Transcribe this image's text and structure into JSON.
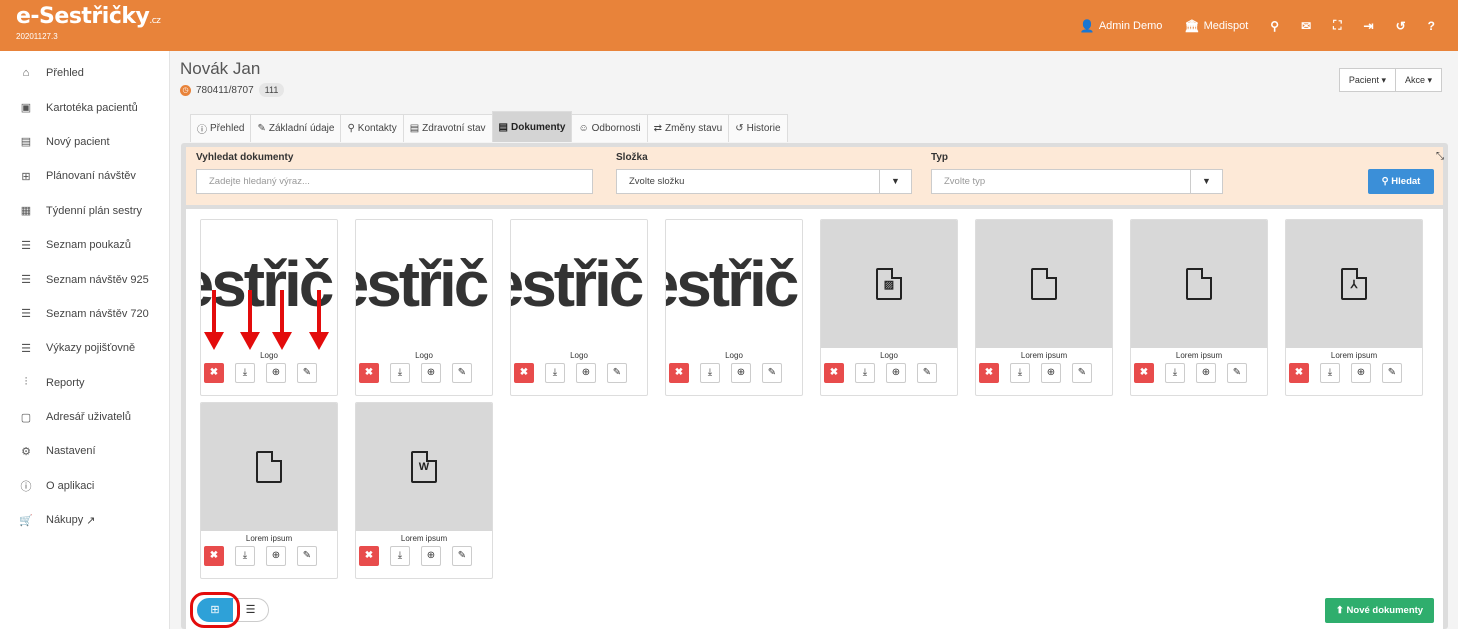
{
  "brand": {
    "logo": "e-Sestřičky",
    "logo_suffix": ".cz",
    "version": "20201127.3",
    "accent": "#e8833a"
  },
  "topnav": [
    {
      "icon": "user-icon",
      "label": "Admin Demo"
    },
    {
      "icon": "building-icon",
      "label": "Medispot"
    },
    {
      "icon": "search-icon",
      "label": ""
    },
    {
      "icon": "envelope-icon",
      "label": ""
    },
    {
      "icon": "fullscreen-icon",
      "label": ""
    },
    {
      "icon": "logout-icon",
      "label": ""
    },
    {
      "icon": "history-icon",
      "label": ""
    },
    {
      "icon": "help-icon",
      "label": ""
    }
  ],
  "sidebar": {
    "items": [
      {
        "icon": "home-icon",
        "label": "Přehled"
      },
      {
        "icon": "id-card-icon",
        "label": "Kartotéka pacientů"
      },
      {
        "icon": "new-patient-icon",
        "label": "Nový pacient"
      },
      {
        "icon": "map-icon",
        "label": "Plánovaní návštěv"
      },
      {
        "icon": "calendar-icon",
        "label": "Týdenní plán sestry"
      },
      {
        "icon": "list-icon",
        "label": "Seznam poukazů"
      },
      {
        "icon": "list-icon",
        "label": "Seznam návštěv 925"
      },
      {
        "icon": "list-icon",
        "label": "Seznam návštěv 720"
      },
      {
        "icon": "list-icon",
        "label": "Výkazy pojišťovně"
      },
      {
        "icon": "chart-icon",
        "label": "Reporty"
      },
      {
        "icon": "address-book-icon",
        "label": "Adresář uživatelů"
      },
      {
        "icon": "gears-icon",
        "label": "Nastavení"
      },
      {
        "icon": "info-icon",
        "label": "O aplikaci"
      },
      {
        "icon": "cart-icon",
        "label": "Nákupy"
      }
    ]
  },
  "patient": {
    "name": "Novák Jan",
    "id": "780411/8707",
    "badge": "111"
  },
  "header_buttons": {
    "patient": "Pacient ▾",
    "actions": "Akce ▾"
  },
  "tabs": [
    {
      "icon": "info-icon",
      "label": "Přehled"
    },
    {
      "icon": "edit-icon",
      "label": "Základní údaje"
    },
    {
      "icon": "pin-icon",
      "label": "Kontakty"
    },
    {
      "icon": "clipboard-icon",
      "label": "Zdravotní stav"
    },
    {
      "icon": "document-icon",
      "label": "Dokumenty",
      "active": true
    },
    {
      "icon": "users-icon",
      "label": "Odbornosti"
    },
    {
      "icon": "exchange-icon",
      "label": "Změny stavu"
    },
    {
      "icon": "history-icon",
      "label": "Historie"
    }
  ],
  "filter": {
    "search_label": "Vyhledat dokumenty",
    "search_placeholder": "Zadejte hledaný výraz...",
    "folder_label": "Složka",
    "folder_value": "Zvolte složku",
    "type_label": "Typ",
    "type_value": "Zvolte typ",
    "search_button": "Hledat"
  },
  "documents": [
    {
      "caption": "Logo",
      "kind": "image"
    },
    {
      "caption": "Logo",
      "kind": "image"
    },
    {
      "caption": "Logo",
      "kind": "image"
    },
    {
      "caption": "Logo",
      "kind": "image"
    },
    {
      "caption": "Logo",
      "kind": "image-file"
    },
    {
      "caption": "Lorem ipsum",
      "kind": "file"
    },
    {
      "caption": "Lorem ipsum",
      "kind": "file"
    },
    {
      "caption": "Lorem ipsum",
      "kind": "pdf"
    },
    {
      "caption": "Lorem ipsum",
      "kind": "file"
    },
    {
      "caption": "Lorem ipsum",
      "kind": "word"
    }
  ],
  "thumb_text": "estřič",
  "footer": {
    "new_documents": "Nové dokumenty"
  }
}
